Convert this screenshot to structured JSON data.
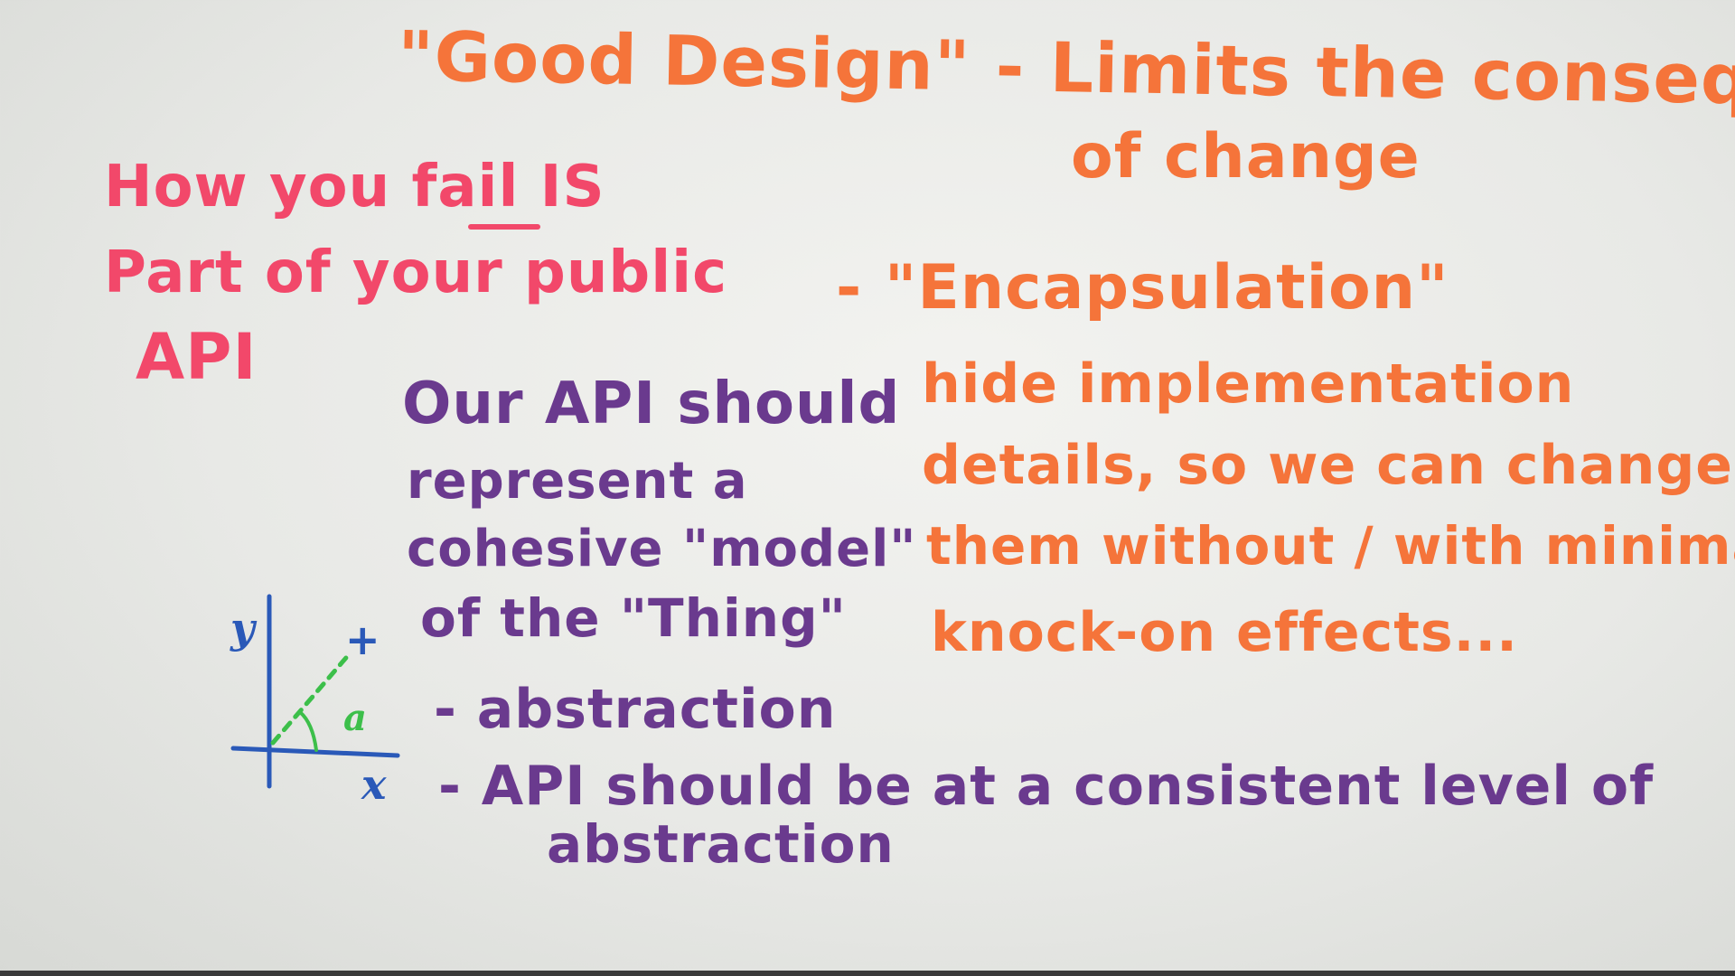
{
  "whiteboard": {
    "title_line1": "\"Good Design\" - Limits the consequences",
    "title_line2": "of change",
    "fail_line1": "How you fail IS",
    "fail_line2": "Part of your public",
    "fail_line3": "API",
    "encapsulation": "- \"Encapsulation\"",
    "hide_line1": "hide implementation",
    "hide_line2": "details, so we can change",
    "hide_line3": "them without / with minimal",
    "hide_line4": "knock-on effects...",
    "api_line1": "Our API should",
    "api_line2": "represent a",
    "api_line3": "cohesive \"model\"",
    "api_line4": "of the \"Thing\"",
    "abstraction": "- abstraction",
    "level_line1": "- API should be at a consistent level of",
    "level_line2": "abstraction",
    "graph_y_label": "y",
    "graph_x_label": "x",
    "graph_plus": "+",
    "graph_angle": "a"
  },
  "colors": {
    "orange_marker": "#f5743a",
    "pink_marker": "#f2486a",
    "purple_marker": "#6a3a8e",
    "green_marker": "#3cbf4a",
    "blue_marker": "#2a59b8"
  }
}
